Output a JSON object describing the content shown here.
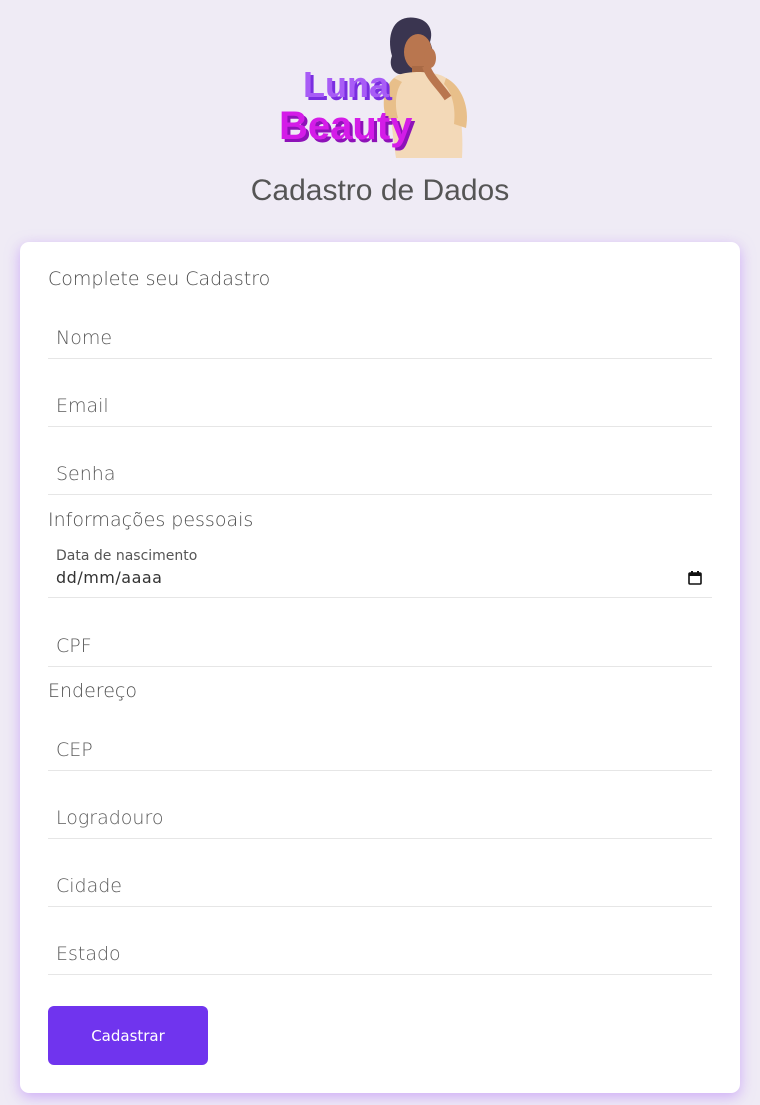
{
  "brand": {
    "line1": "Luna",
    "line2": "Beauty"
  },
  "page_title": "Cadastro de Dados",
  "form": {
    "heading": "Complete seu Cadastro",
    "account_fields": {
      "nome_placeholder": "Nome",
      "email_placeholder": "Email",
      "senha_placeholder": "Senha"
    },
    "personal": {
      "heading": "Informações pessoais",
      "birthdate_caption": "Data de nascimento",
      "birthdate_value": "dd/mm/aaaa",
      "cpf_placeholder": "CPF"
    },
    "address": {
      "heading": "Endereço",
      "cep_placeholder": "CEP",
      "logradouro_placeholder": "Logradouro",
      "cidade_placeholder": "Cidade",
      "estado_placeholder": "Estado"
    },
    "submit_label": "Cadastrar"
  },
  "colors": {
    "background": "#efebf5",
    "accent": "#7034ee",
    "logo_purple": "#9b3cf0",
    "logo_magenta": "#d41ce8"
  },
  "icons": {
    "calendar": "calendar-icon"
  }
}
